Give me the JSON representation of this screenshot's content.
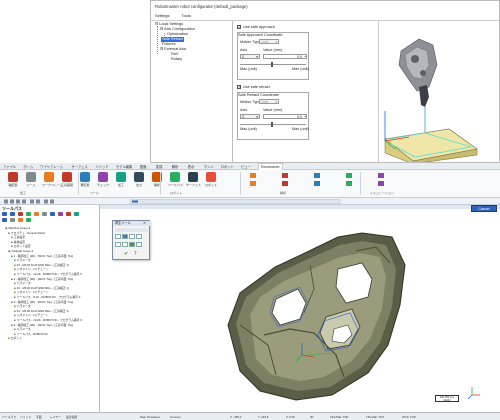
{
  "configurator": {
    "title": "Robotmaster robot configurator (default_package)",
    "menu": [
      "Settings",
      "Tools"
    ],
    "tree": [
      {
        "label": "Local Settings",
        "indent": 0
      },
      {
        "label": "Axis Configuration",
        "indent": 1
      },
      {
        "label": "Optimization",
        "indent": 2
      },
      {
        "label": "Safe Retract",
        "indent": 1,
        "selected": true
      },
      {
        "label": "Fixtures",
        "indent": 1
      },
      {
        "label": "External Axis",
        "indent": 1
      },
      {
        "label": "Rail",
        "indent": 2
      },
      {
        "label": "Rotary",
        "indent": 2
      }
    ],
    "approach": {
      "checkbox_label": "Use safe approach",
      "group_label": "Safe Approach Coordinate",
      "motion_type_label": "Motion Type",
      "motion_type_value": "Joint",
      "axis_label": "Axis",
      "axis_value": "Z",
      "value_label": "Value (mm)",
      "value": "0.0",
      "min_label": "Max (unit)",
      "max_label": "Max (unit)"
    },
    "retract": {
      "checkbox_label": "Use safe retract",
      "group_label": "Safe Retract Coordinate",
      "motion_type_label": "Motion Type",
      "motion_type_value": "Joint",
      "axis_label": "Axis",
      "axis_value": "Z",
      "value_label": "Value (mm)",
      "value": "0.0",
      "min_label": "Max (unit)",
      "max_label": "Max (unit)"
    }
  },
  "app": {
    "ribbon_tabs": [
      "ファイル",
      "ホーム",
      "ワイヤフレーム",
      "サーフェス",
      "ソリッド",
      "モデル編集",
      "図面",
      "変換",
      "解析",
      "表示",
      "マシン",
      "ロボット",
      "ビュー",
      "Robotmaster"
    ],
    "ribbon_buttons": [
      {
        "label": "軸配置",
        "icon": "axis-icon",
        "color": "#c0392b"
      },
      {
        "label": "ツール",
        "icon": "tool-icon",
        "color": "#7f8c8d"
      },
      {
        "label": "ワークフレーム",
        "icon": "frame-icon",
        "color": "#e67e22"
      },
      {
        "label": "工具座標",
        "icon": "coord-icon",
        "color": "#c0392b"
      },
      {
        "label": "再配置",
        "icon": "move-icon",
        "color": "#2980b9"
      },
      {
        "label": "チェック",
        "icon": "check-icon",
        "color": "#8e44ad"
      },
      {
        "label": "加工",
        "icon": "process-icon",
        "color": "#16a085"
      },
      {
        "label": "出力",
        "icon": "output-icon",
        "color": "#34495e"
      },
      {
        "label": "解析",
        "icon": "analyze-icon",
        "color": "#d35400"
      },
      {
        "label": "ツールパス",
        "icon": "path-icon",
        "color": "#27ae60"
      },
      {
        "label": "サーフェス",
        "icon": "surface-icon",
        "color": "#2c3e50"
      },
      {
        "label": "ロボット",
        "icon": "robot-icon",
        "color": "#e74c3c"
      }
    ],
    "ribbon_groups": [
      "加工",
      "ツール",
      "ロボット",
      "解析",
      "シミュレーション"
    ],
    "panel_title": "ツールパス",
    "tree_items": [
      "Machine Group-1",
      "プロパティ - Generic Robot",
      "工具設定",
      "素材設定",
      "ロボット設定",
      "Toolpath Group-1",
      "1 - 輪郭加工 (2D) - [WCS: Top] - [工具平面: Top]",
      "パラメータ",
      "#1 - M6.00 FLAT END MILL - [工具補正 1]",
      "ジオメトリ - (1) チェーン",
      "ツールパス - 12.4K - ROBOT.NC - プログラム番号 0",
      "2 - 輪郭加工 (2D) - [WCS: Top] - [工具平面: Top]",
      "パラメータ",
      "#1 - M6.00 FLAT END MILL - [工具補正 1]",
      "ジオメトリ - (1) チェーン",
      "ツールパス - 8.1K - ROBOT.NC - プログラム番号 0",
      "3 - 輪郭加工 (2D) - [WCS: Top] - [工具平面: Top]",
      "パラメータ",
      "#1 - M6.00 FLAT END MILL - [工具補正 1]",
      "ジオメトリ - (1) チェーン",
      "ツールパス - 10.2K - ROBOT.NC - プログラム番号 0",
      "4 - 輪郭加工 (2D) - [WCS: Top] - [工具平面: Top]",
      "パラメータ",
      "ツールパス - ROBOT.NC",
      "ロボット"
    ],
    "cancel_label": "Cancel",
    "dialog_title": "再生ツール",
    "scale_label": "100.000 mm",
    "scale_sub": "Metric",
    "status_items": [
      "ツールパス",
      "ソリッド",
      "平面",
      "レイヤー",
      "最近使用",
      "Main Viewsheet",
      "Gnomon",
      "X: -355.3",
      "Y: 416.8",
      "Z: 0.00",
      "3D",
      "CPLANE: TOP",
      "TPLANE: TOP",
      "WCS: TOP"
    ]
  }
}
